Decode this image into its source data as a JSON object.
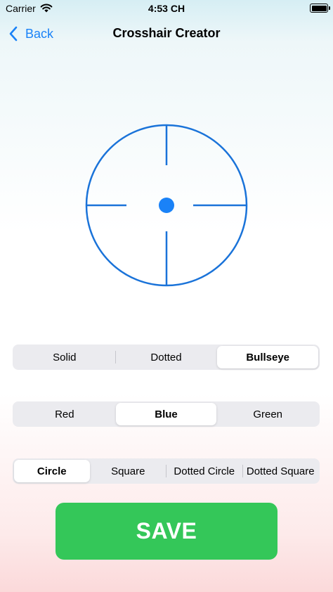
{
  "status_bar": {
    "carrier": "Carrier",
    "time": "4:53 CH"
  },
  "nav": {
    "back_label": "Back",
    "title": "Crosshair Creator"
  },
  "style_control": {
    "options": [
      "Solid",
      "Dotted",
      "Bullseye"
    ],
    "selected": "Bullseye"
  },
  "color_control": {
    "options": [
      "Red",
      "Blue",
      "Green"
    ],
    "selected": "Blue"
  },
  "shape_control": {
    "options": [
      "Circle",
      "Square",
      "Dotted Circle",
      "Dotted Square"
    ],
    "selected": "Circle"
  },
  "save_label": "SAVE",
  "colors": {
    "accent": "#1a82f7",
    "crosshair": "#1a73d9",
    "save": "#34c759"
  },
  "icons": {
    "back": "chevron-left-icon",
    "wifi": "wifi-icon",
    "battery": "battery-icon"
  }
}
